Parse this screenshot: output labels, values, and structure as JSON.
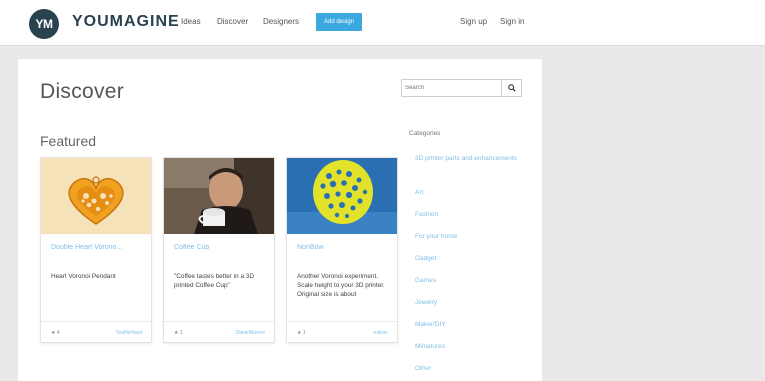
{
  "header": {
    "logo_badge": "YM",
    "logo_text": "YOUMAGINE",
    "nav": [
      "Ideas",
      "Discover",
      "Designers"
    ],
    "add_button": "Add design",
    "sign_up": "Sign up",
    "sign_in": "Sign in",
    "brand_color": "#2a4150",
    "accent_color": "#3ba9e0"
  },
  "page": {
    "title": "Discover",
    "search_placeholder": "Search",
    "featured_title": "Featured"
  },
  "cards": [
    {
      "title": "Double Heart Vorono...",
      "description": "Heart Voronoi Pendant",
      "likes": "4",
      "author": "YesHeHasIt"
    },
    {
      "title": "Coffee Cup",
      "description": "\"Coffee tastes better in a 3D printed Coffee Cup\"",
      "likes": "1",
      "author": "DanielNorree"
    },
    {
      "title": "NonBow",
      "description": "Another Voronoi experiment. Scale height to your 3D printer. Original size is about",
      "likes": "1",
      "author": "nolivrc"
    }
  ],
  "categories": {
    "heading": "Categories",
    "items": [
      "3D printer parts and enhancements",
      "Art",
      "Fashion",
      "For your home",
      "Gadget",
      "Games",
      "Jewelry",
      "Maker/DIY",
      "Miniatures",
      "Other"
    ]
  }
}
